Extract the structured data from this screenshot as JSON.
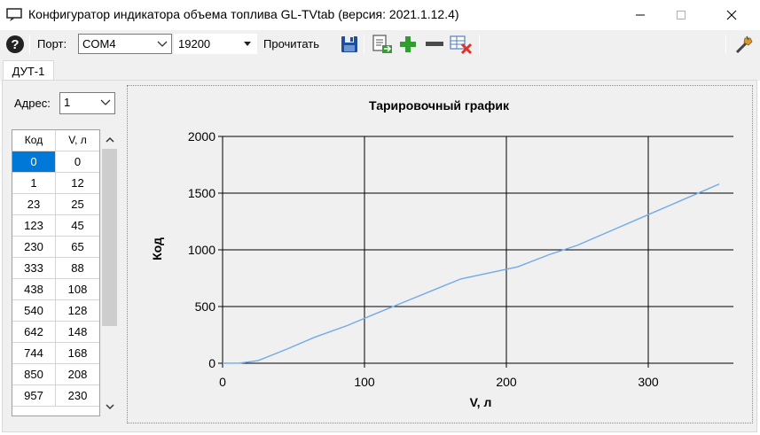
{
  "window": {
    "title": "Конфигуратор индикатора объема топлива GL-TVtab (версия: 2021.1.12.4)"
  },
  "toolbar": {
    "port_label": "Порт:",
    "port_value": "COM4",
    "baud_value": "19200",
    "read_label": "Прочитать"
  },
  "tabs": [
    {
      "label": "ДУТ-1"
    }
  ],
  "address": {
    "label": "Адрес:",
    "value": "1"
  },
  "table": {
    "headers": [
      "Код",
      "V, л"
    ],
    "rows": [
      [
        "0",
        "0"
      ],
      [
        "1",
        "12"
      ],
      [
        "23",
        "25"
      ],
      [
        "123",
        "45"
      ],
      [
        "230",
        "65"
      ],
      [
        "333",
        "88"
      ],
      [
        "438",
        "108"
      ],
      [
        "540",
        "128"
      ],
      [
        "642",
        "148"
      ],
      [
        "744",
        "168"
      ],
      [
        "850",
        "208"
      ],
      [
        "957",
        "230"
      ]
    ]
  },
  "chart_data": {
    "type": "line",
    "title": "Тарировочный график",
    "xlabel": "V, л",
    "ylabel": "Код",
    "xlim": [
      0,
      360
    ],
    "ylim": [
      0,
      2000
    ],
    "xticks": [
      0,
      100,
      200,
      300
    ],
    "yticks": [
      0,
      500,
      1000,
      1500,
      2000
    ],
    "grid": true,
    "line_color": "#72aae8",
    "series": [
      {
        "x": [
          0,
          12,
          25,
          45,
          65,
          88,
          108,
          128,
          148,
          168,
          208,
          230,
          250,
          300,
          350
        ],
        "y": [
          0,
          1,
          23,
          123,
          230,
          333,
          438,
          540,
          642,
          744,
          850,
          957,
          1040,
          1310,
          1580
        ]
      }
    ]
  },
  "icons": {
    "help": "help-icon",
    "save": "save-icon",
    "import": "import-icon",
    "add": "add-icon",
    "remove": "remove-icon",
    "clear": "clear-icon",
    "settings": "settings-icon"
  }
}
